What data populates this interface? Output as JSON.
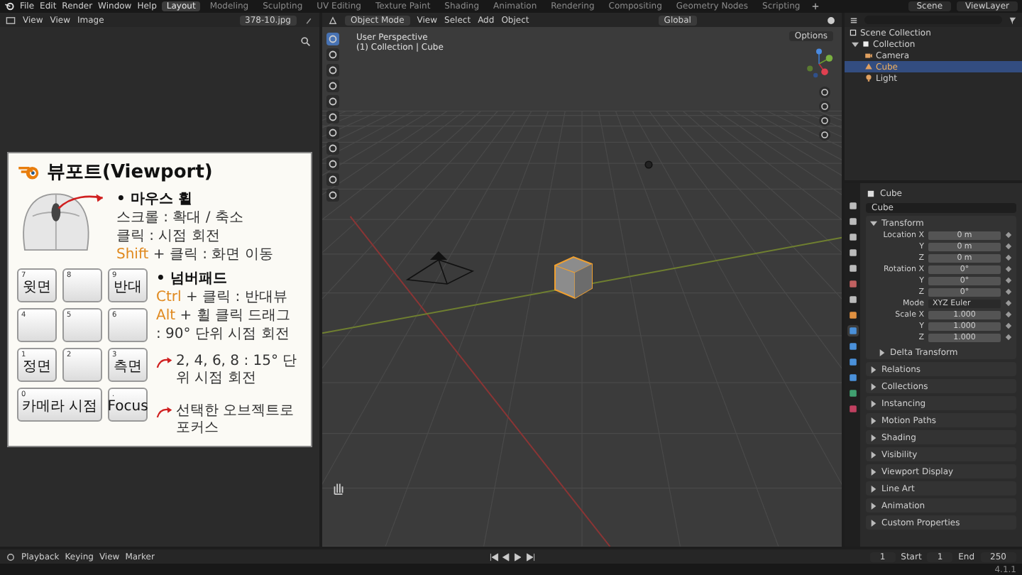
{
  "menu": [
    "File",
    "Edit",
    "Render",
    "Window",
    "Help"
  ],
  "workspaces": [
    {
      "label": "Layout",
      "selected": true
    },
    {
      "label": "Modeling",
      "selected": false
    },
    {
      "label": "Sculpting",
      "selected": false
    },
    {
      "label": "UV Editing",
      "selected": false
    },
    {
      "label": "Texture Paint",
      "selected": false
    },
    {
      "label": "Shading",
      "selected": false
    },
    {
      "label": "Animation",
      "selected": false
    },
    {
      "label": "Rendering",
      "selected": false
    },
    {
      "label": "Compositing",
      "selected": false
    },
    {
      "label": "Geometry Nodes",
      "selected": false
    },
    {
      "label": "Scripting",
      "selected": false
    }
  ],
  "top_right": {
    "scene": "Scene",
    "view_layer": "ViewLayer"
  },
  "image_editor": {
    "menus": [
      "View",
      "View",
      "Image"
    ],
    "image_name": "378-10.jpg"
  },
  "card": {
    "title": "뷰포트(Viewport)",
    "mouse": {
      "heading": "• 마우스 휠",
      "lines": [
        {
          "text": "스크롤 : 확대 / 축소"
        },
        {
          "text": "클릭 : 시점 회전"
        },
        {
          "key": "Shift",
          "text": "+ 클릭 : 화면 이동"
        }
      ]
    },
    "numpad": {
      "heading": "• 넘버패드",
      "lines": [
        {
          "key": "Ctrl",
          "text": "+ 클릭 : 반대뷰"
        },
        {
          "key": "Alt",
          "text": "+ 휠 클릭 드래그"
        },
        {
          "text": ": 90° 단위 시점 회전"
        }
      ]
    },
    "rotate_note": "2, 4, 6, 8 : 15° 단위 시점 회전",
    "focus_note": "선택한 오브젝트로 포커스",
    "keys": [
      {
        "number": "7",
        "label": "윗면",
        "kind": "normal"
      },
      {
        "number": "8",
        "kind": "normal"
      },
      {
        "number": "9",
        "label": "반대",
        "kind": "normal"
      },
      {
        "number": "4",
        "kind": "normal"
      },
      {
        "number": "5",
        "kind": "normal"
      },
      {
        "number": "6",
        "kind": "normal"
      },
      {
        "number": "1",
        "label": "정면",
        "kind": "normal"
      },
      {
        "number": "2",
        "kind": "normal"
      },
      {
        "number": "3",
        "label": "측면",
        "kind": "normal"
      },
      {
        "number": "0",
        "label": "카메라 시점",
        "kind": "wide"
      },
      {
        "number": ".",
        "label": "Focus",
        "kind": "normal"
      }
    ]
  },
  "viewport": {
    "mode": "Object Mode",
    "menus": [
      "View",
      "Select",
      "Add",
      "Object"
    ],
    "orientation": "Global",
    "options": "Options",
    "overlay_title": "User Perspective",
    "overlay_sub": "(1) Collection | Cube"
  },
  "outliner": {
    "root": "Scene Collection",
    "items": [
      {
        "label": "Collection",
        "expanded": true,
        "children": [
          {
            "label": "Camera",
            "kind": "camera",
            "selected": false
          },
          {
            "label": "Cube",
            "kind": "mesh",
            "selected": true
          },
          {
            "label": "Light",
            "kind": "light",
            "selected": false
          }
        ]
      }
    ]
  },
  "properties": {
    "object": "Cube",
    "name_field": "Cube",
    "transform": {
      "title": "Transform",
      "expanded": true,
      "rows": [
        {
          "label": "Location X",
          "value": "0 m",
          "kind": "number"
        },
        {
          "label": "Y",
          "value": "0 m",
          "kind": "number"
        },
        {
          "label": "Z",
          "value": "0 m",
          "kind": "number"
        },
        {
          "label": "Rotation X",
          "value": "0°",
          "kind": "number"
        },
        {
          "label": "Y",
          "value": "0°",
          "kind": "number"
        },
        {
          "label": "Z",
          "value": "0°",
          "kind": "number"
        },
        {
          "label": "Mode",
          "value": "XYZ Euler",
          "kind": "dropdown"
        },
        {
          "label": "Scale X",
          "value": "1.000",
          "kind": "number"
        },
        {
          "label": "Y",
          "value": "1.000",
          "kind": "number"
        },
        {
          "label": "Z",
          "value": "1.000",
          "kind": "number"
        }
      ],
      "subpanel": {
        "title": "Delta Transform",
        "expanded": false
      }
    },
    "panels": [
      {
        "title": "Relations",
        "expanded": false
      },
      {
        "title": "Collections",
        "expanded": false
      },
      {
        "title": "Instancing",
        "expanded": false
      },
      {
        "title": "Motion Paths",
        "expanded": false
      },
      {
        "title": "Shading",
        "expanded": false
      },
      {
        "title": "Visibility",
        "expanded": false
      },
      {
        "title": "Viewport Display",
        "expanded": false
      },
      {
        "title": "Line Art",
        "expanded": false
      },
      {
        "title": "Animation",
        "expanded": false
      },
      {
        "title": "Custom Properties",
        "expanded": false
      }
    ]
  },
  "timeline": {
    "menus": [
      "Playback",
      "Keying",
      "View",
      "Marker"
    ],
    "frame": "1",
    "start_label": "Start",
    "start": "1",
    "end_label": "End",
    "end": "250"
  },
  "status": {
    "version": "4.1.1"
  }
}
